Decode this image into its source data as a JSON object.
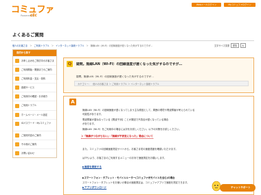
{
  "header": {
    "logo_main": "コミュファ",
    "logo_sub": "Powered by",
    "logo_brand": "ctc",
    "login_web": "Webメールログイン",
    "login_mypage": "Myコミュファログイン"
  },
  "page": {
    "title": "よくあるご質問"
  },
  "breadcrumb": [
    "個人のお客さま",
    "ご利用トラブル",
    "インターネット接続トラブル",
    "無線LAN（Wi-Fi）の回線速度が遅くなった気がするのですが…"
  ],
  "text_size": {
    "label": "文字サイズ変更",
    "std": "標準",
    "large": "大"
  },
  "sidebar": {
    "heading": "目的から探す",
    "items": [
      {
        "label": "お申し込みをご検討中のお客さま"
      },
      {
        "label": "ご利用開始・開通までのご案内"
      },
      {
        "label": "ご利用料金・支払・契約"
      },
      {
        "label": "各種サービス"
      },
      {
        "label": "ご利用中の確認・お手続き"
      },
      {
        "label": "ご利用トラブル"
      },
      {
        "label": "ホームページ・メール設定"
      },
      {
        "label": "IDパスワード・Myコミュファ"
      },
      {
        "label": "ご契約内容のご案内"
      },
      {
        "label": "その他のご案内"
      },
      {
        "label": "お問い合わせ"
      }
    ]
  },
  "question": {
    "badge": "Q",
    "title": "疑問。無線LAN（Wi-Fi）の回線速度が遅くなった気がするのですが…",
    "subtitle": "疑問。無線LAN（Wi-Fi）の回線速度が遅くなった気がするのですが…",
    "category": "カテゴリー：　個人のお客さま ＞ ご利用トラブル ＞ インターネット接続トラブル"
  },
  "answer": {
    "badge": "A",
    "lines": [
      "無線LAN（Wi-Fi）の回線速度が遅くなってしまう主な原因として、周囲の環境や電波障害が考えられている",
      "可能性があります。",
      "電波障害が重ねなっている【電波干渉】ことが原因で不具合が遅くなっている場合",
      "があります。",
      "無線LAN（Wi-Fi）をご利用中の場合には次をお試しください。以下の対策をお試しください。"
    ],
    "highlight": "＞「無線がつながらない」・「無線が不安定になった」場合について",
    "lines2": [
      "また、コミュファの回線速度測定サイトから、お客さま宅の速度適度を確認いただけます。",
      "はTPいより、お客さまのご利用するメニューのお対で速度測定をお願いします。"
    ],
    "link1": "▶速度を測定する",
    "sp_heading": "▶スマートフォン・タブレット・モバイルルーター(コミュファ光モバイルを含む)の場合",
    "sp_line": "スマートフォン・タブレットをお使いの場合の速度測定は、コミュファアプリで速度を測定できます。",
    "link2": "▶アプリダウンロード"
  },
  "chat": {
    "label": "チャットサポート"
  },
  "colors": {
    "accent": "#e8830c",
    "accent_light": "#f5a623",
    "link": "#1a4fa0",
    "warning": "#d01010"
  }
}
